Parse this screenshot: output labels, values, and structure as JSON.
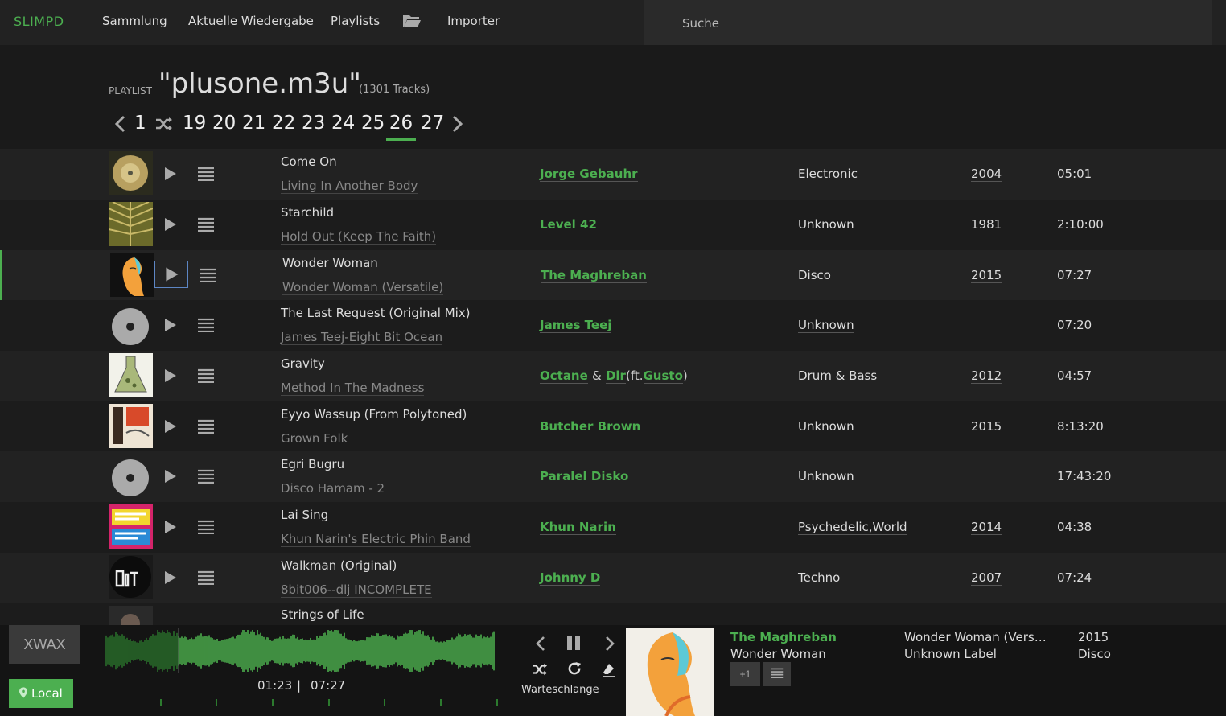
{
  "nav": {
    "logo": "SLIMPD",
    "items": [
      "Sammlung",
      "Aktuelle Wiedergabe",
      "Playlists",
      "Importer"
    ],
    "search_placeholder": "Suche"
  },
  "playlist": {
    "label": "PLAYLIST",
    "title": "\"plusone.m3u\"",
    "count": "(1301 Tracks)"
  },
  "pager": {
    "first": "1",
    "pages": [
      "19",
      "20",
      "21",
      "22",
      "23",
      "24",
      "25",
      "26",
      "27"
    ],
    "active": "26"
  },
  "tracks": [
    {
      "title": "Come On",
      "album": "Living In Another Body",
      "artists": [
        "Jorge Gebauhr"
      ],
      "genre": "Electronic",
      "year": "2004",
      "duration": "05:01"
    },
    {
      "title": "Starchild",
      "album": "Hold Out (Keep The Faith)",
      "artists": [
        "Level 42"
      ],
      "genre": "Unknown",
      "year": "1981",
      "duration": "2:10:00"
    },
    {
      "title": "Wonder Woman",
      "album": "Wonder Woman (Versatile)",
      "artists": [
        "The Maghreban"
      ],
      "genre": "Disco",
      "year": "2015",
      "duration": "07:27"
    },
    {
      "title": "The Last Request (Original Mix)",
      "album": "James Teej-Eight Bit Ocean",
      "artists": [
        "James Teej"
      ],
      "genre": "Unknown",
      "year": "",
      "duration": "07:20"
    },
    {
      "title": "Gravity",
      "album": "Method In The Madness",
      "artists": [
        "Octane",
        "Dlr",
        "Gusto"
      ],
      "genre": "Drum & Bass",
      "year": "2012",
      "duration": "04:57"
    },
    {
      "title": "Eyyo Wassup (From Polytoned)",
      "album": "Grown Folk",
      "artists": [
        "Butcher Brown"
      ],
      "genre": "Unknown",
      "year": "2015",
      "duration": "8:13:20"
    },
    {
      "title": "Egri Bugru",
      "album": "Disco Hamam - 2",
      "artists": [
        "Paralel Disko"
      ],
      "genre": "Unknown",
      "year": "",
      "duration": "17:43:20"
    },
    {
      "title": "Lai Sing",
      "album": "Khun Narin's Electric Phin Band",
      "artists": [
        "Khun Narin"
      ],
      "genre": "Psychedelic,World",
      "year": "2014",
      "duration": "04:38"
    },
    {
      "title": "Walkman (Original)",
      "album": "8bit006--dlj INCOMPLETE",
      "artists": [
        "Johnny D"
      ],
      "genre": "Techno",
      "year": "2007",
      "duration": "07:24"
    },
    {
      "title": "Strings of Life",
      "album": "",
      "artists": [],
      "genre": "",
      "year": "",
      "duration": ""
    }
  ],
  "artist_joiners": {
    "amp": "&",
    "ft": "(ft.",
    "close": ")"
  },
  "player": {
    "xwax": "XWAX",
    "local": "Local",
    "elapsed": "01:23",
    "separator": "|",
    "total": "07:27",
    "queue_label": "Warteschlange",
    "artist": "The Maghreban",
    "title": "Wonder Woman",
    "plus_one": "+1",
    "album": "Wonder Woman (Versatile)",
    "label": "Unknown Label",
    "year": "2015",
    "genre": "Disco",
    "progress": 0.19
  },
  "colors": {
    "accent": "#4caf50",
    "bg": "#1a1a1a",
    "selection": "#5d86c4"
  }
}
